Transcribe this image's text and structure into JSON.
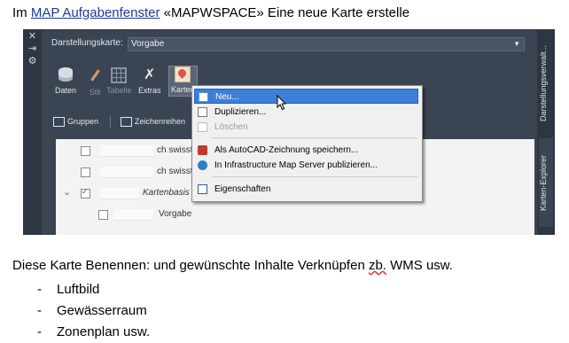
{
  "heading": {
    "prefix": "Im ",
    "link": "MAP Aufgabenfenster",
    "suffix": " «MAPWSPACE» Eine neue Karte erstelle"
  },
  "window": {
    "left_strip": [
      "✕",
      "⇥",
      "⚙"
    ],
    "combo_label": "Darstellungskarte:",
    "combo_value": "Vorgabe",
    "toolbar": [
      {
        "label": "Daten",
        "icon": "database-icon",
        "enabled": true
      },
      {
        "label": "Stil",
        "icon": "brush-icon",
        "enabled": false
      },
      {
        "label": "Tabelle",
        "icon": "table-icon",
        "enabled": false
      },
      {
        "label": "Extras",
        "icon": "tools-icon",
        "enabled": true
      },
      {
        "label": "Karten",
        "icon": "map-icon",
        "enabled": true
      }
    ],
    "subtoolbar": {
      "groups_label": "Gruppen",
      "order_label": "Zeichenreihen"
    },
    "side_tabs": [
      "Darstellungsverwalt...",
      "Karten-Explorer"
    ],
    "tree": [
      {
        "text": "ch swisst",
        "checked": false,
        "italic": false
      },
      {
        "text": "ch swisst",
        "checked": false,
        "italic": false
      },
      {
        "text": "Kartenbasis",
        "checked": true,
        "italic": true
      },
      {
        "text": "Vorgabe",
        "checked": false,
        "italic": false
      }
    ]
  },
  "context_menu": {
    "items": [
      {
        "label": "Neu...",
        "icon": "new-map-icon",
        "selected": true,
        "disabled": false
      },
      {
        "label": "Duplizieren...",
        "icon": "duplicate-icon",
        "selected": false,
        "disabled": false
      },
      {
        "label": "Löschen",
        "icon": "delete-icon",
        "selected": false,
        "disabled": true
      },
      {
        "label": "Als AutoCAD-Zeichnung speichern...",
        "icon": "autocad-icon",
        "selected": false,
        "disabled": false
      },
      {
        "label": "In Infrastructure Map Server publizieren...",
        "icon": "globe-icon",
        "selected": false,
        "disabled": false
      },
      {
        "label": "Eigenschaften",
        "icon": "properties-icon",
        "selected": false,
        "disabled": false
      }
    ]
  },
  "body": {
    "text_before": "Diese Karte Benennen: und gewünschte Inhalte Verknüpfen ",
    "text_wavy": "zb.",
    "text_after": " WMS usw.",
    "list": [
      "Luftbild",
      "Gewässerraum",
      "Zonenplan usw."
    ]
  }
}
